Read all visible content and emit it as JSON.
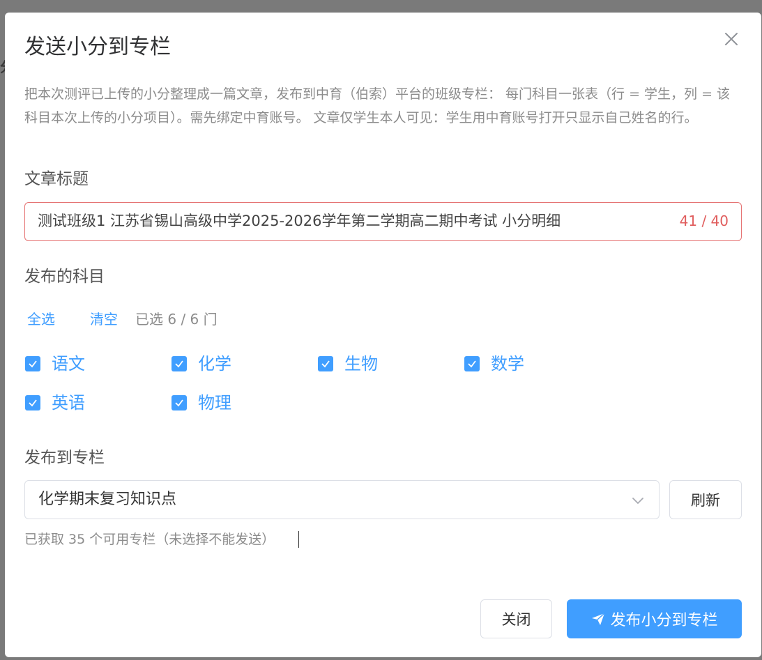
{
  "dialog": {
    "title": "发送小分到专栏",
    "description": "把本次测评已上传的小分整理成一篇文章，发布到中育（伯索）平台的班级专栏： 每门科目一张表（行 = 学生，列 = 该科目本次上传的小分项目）。需先绑定中育账号。 文章仅学生本人可见：学生用中育账号打开只显示自己姓名的行。"
  },
  "article_title": {
    "label": "文章标题",
    "value": "测试班级1 江苏省锡山高级中学2025-2026学年第二学期高二期中考试 小分明细",
    "counter": "41 / 40"
  },
  "subjects": {
    "label": "发布的科目",
    "select_all": "全选",
    "clear": "清空",
    "selected_count": "已选 6 / 6 门",
    "items": [
      {
        "label": "语文",
        "checked": true
      },
      {
        "label": "化学",
        "checked": true
      },
      {
        "label": "生物",
        "checked": true
      },
      {
        "label": "数学",
        "checked": true
      },
      {
        "label": "英语",
        "checked": true
      },
      {
        "label": "物理",
        "checked": true
      }
    ]
  },
  "column": {
    "label": "发布到专栏",
    "selected": "化学期末复习知识点",
    "refresh": "刷新",
    "hint": "已获取 35 个可用专栏（未选择不能发送）"
  },
  "footer": {
    "close": "关闭",
    "publish": "发布小分到专栏"
  },
  "colors": {
    "primary": "#409eff",
    "error": "#e05d5d"
  }
}
